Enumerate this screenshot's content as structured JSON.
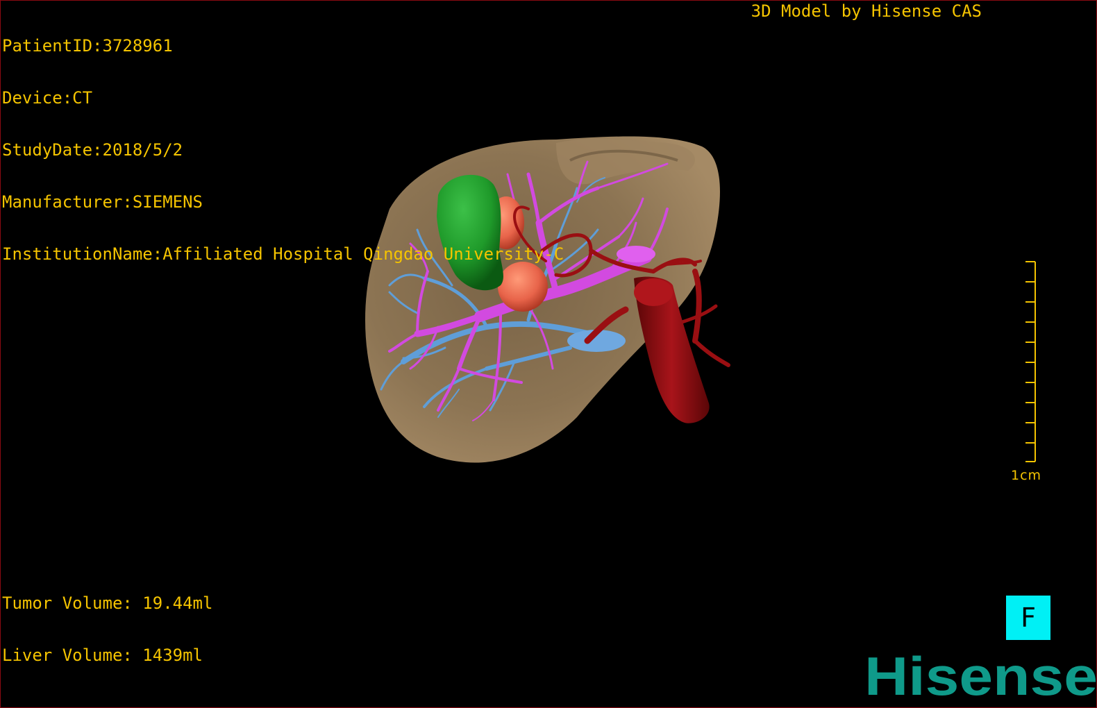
{
  "header": {
    "patient_id": "PatientID:3728961",
    "device": "Device:CT",
    "study_date": "StudyDate:2018/5/2",
    "manufacturer": "Manufacturer:SIEMENS",
    "institution": "InstitutionName:Affiliated Hospital Qingdao University-C",
    "model_credit": "3D Model by Hisense CAS"
  },
  "volumes": {
    "tumor": "Tumor Volume: 19.44ml",
    "liver": "Liver Volume: 1439ml"
  },
  "scale": {
    "label": "1cm"
  },
  "orientation": {
    "label": "F"
  },
  "brand": {
    "logo_text": "Hisense"
  },
  "colors": {
    "overlay_text": "#f5c400",
    "liver": "#8c7453",
    "tumor_green": "#1f9a2a",
    "tumor_orange": "#e8644a",
    "portal_vein": "#d24ae0",
    "hepatic_vein": "#5f9ed8",
    "artery_ivc": "#9a0f12",
    "orientation_button": "#00f0f5",
    "logo": "#0f9a8a"
  }
}
